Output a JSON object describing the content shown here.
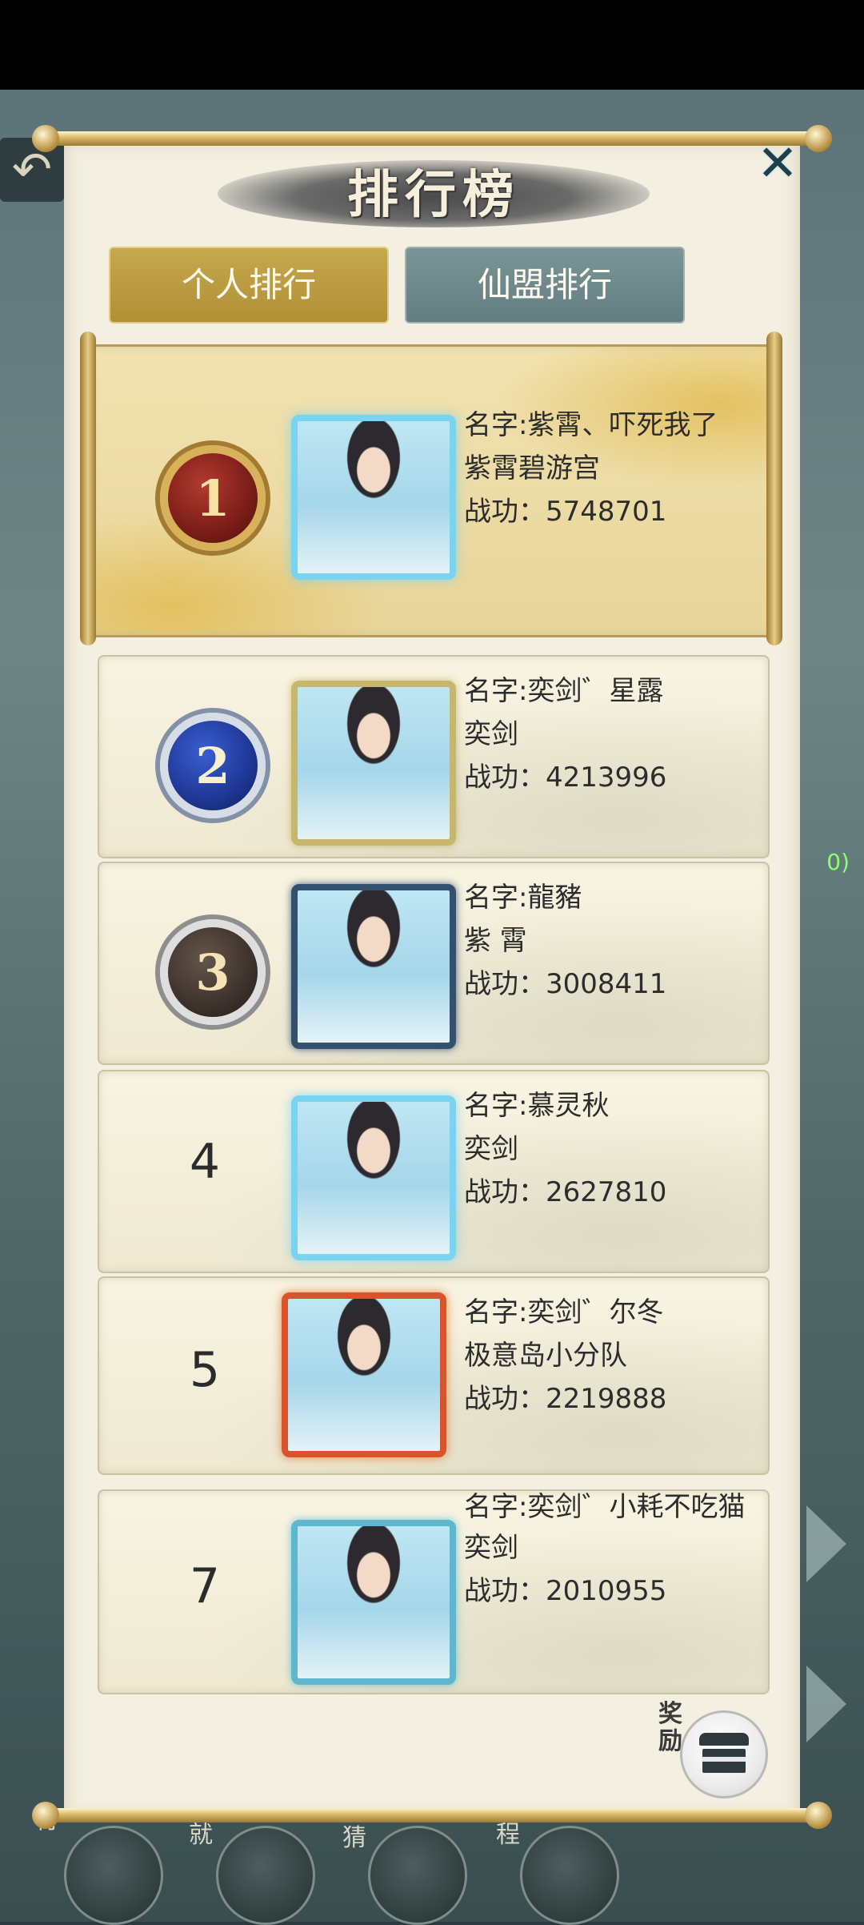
{
  "title": "排行榜",
  "tabs": [
    {
      "label": "个人排行",
      "active": true
    },
    {
      "label": "仙盟排行",
      "active": false
    }
  ],
  "close_icon": "close-icon",
  "entries": [
    {
      "rank": "1",
      "rank_style": "gold-medal",
      "name": "名字:紫霄、吓死我了",
      "alliance": "紫霄碧游宫",
      "power": "战功：5748701"
    },
    {
      "rank": "2",
      "rank_style": "silver-medal",
      "name": "名字:奕剑゛星露",
      "alliance": "奕剑",
      "power": "战功：4213996"
    },
    {
      "rank": "3",
      "rank_style": "bronze-medal",
      "name": "名字:龍豬",
      "alliance": "紫 霄",
      "power": "战功：3008411"
    },
    {
      "rank": "4",
      "rank_style": "plain",
      "name": "名字:慕灵秋",
      "alliance": "奕剑",
      "power": "战功：2627810"
    },
    {
      "rank": "5",
      "rank_style": "plain",
      "name": "名字:奕剑゛尔冬",
      "alliance": "极意岛小分队",
      "power": "战功：2219888"
    }
  ],
  "self_entry": {
    "rank": "7",
    "name": "名字:奕剑゛小耗不吃猫",
    "alliance": "奕剑",
    "power": "战功：2010955"
  },
  "reward": {
    "label": "奖励",
    "icon": "treasure-chest-icon"
  },
  "background": {
    "side_text": "0)",
    "bottom_labels": [
      "行",
      "就",
      "猜",
      "程"
    ],
    "back_icon": "back-arrow-icon"
  },
  "colors": {
    "tab_active": "#b89a40",
    "tab_inactive": "#6b8788",
    "panel_bg": "#f3f0e1",
    "gold_trim": "#d7b25a"
  }
}
